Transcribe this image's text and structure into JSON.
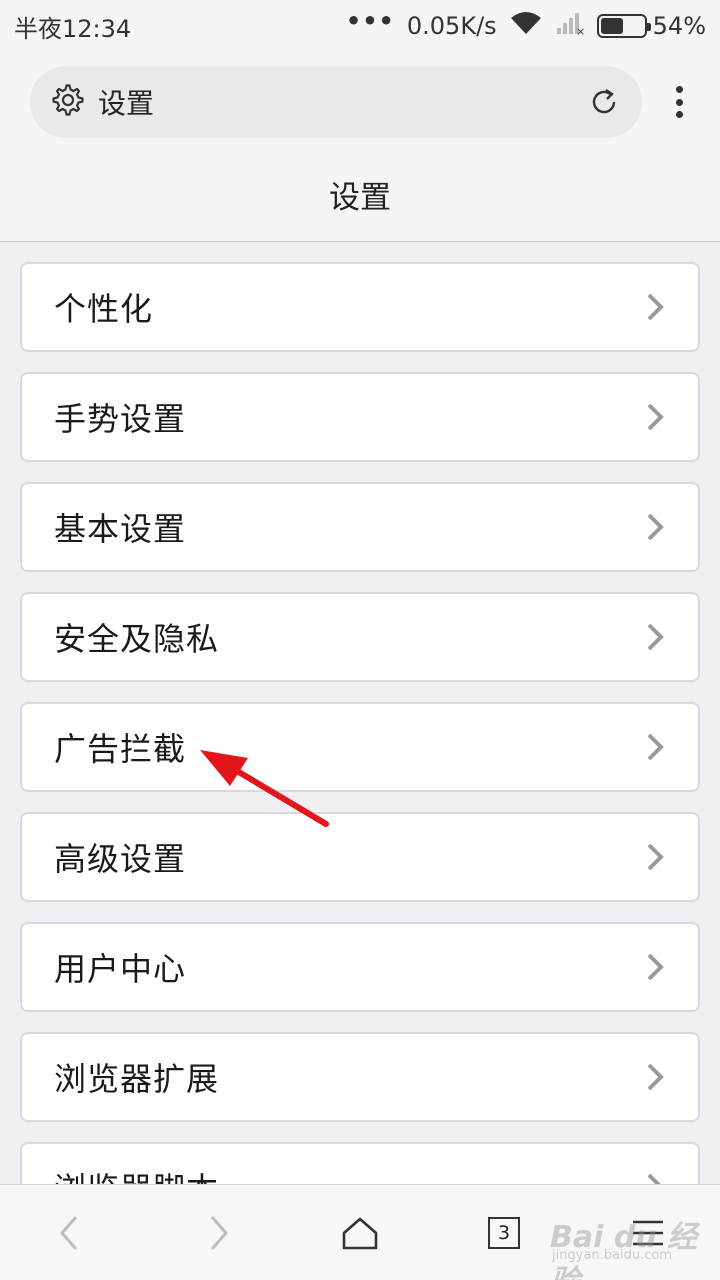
{
  "status_bar": {
    "time": "半夜12:34",
    "network_speed": "0.05K/s",
    "battery_percent": "54%",
    "battery_level": 0.54
  },
  "browser": {
    "url_bar_text": "设置",
    "page_title": "设置",
    "tab_count": "3"
  },
  "settings_items": [
    {
      "label": "个性化"
    },
    {
      "label": "手势设置"
    },
    {
      "label": "基本设置"
    },
    {
      "label": "安全及隐私"
    },
    {
      "label": "广告拦截"
    },
    {
      "label": "高级设置"
    },
    {
      "label": "用户中心"
    },
    {
      "label": "浏览器扩展"
    },
    {
      "label": "浏览器脚本"
    }
  ],
  "watermark": {
    "text": "Bai du 经验",
    "subtext": "jingyan.baidu.com"
  },
  "colors": {
    "annotation_arrow": "#e3161b",
    "background": "#efeff4"
  },
  "icons": [
    "gear-icon",
    "refresh-icon",
    "more-menu-icon",
    "chevron-right-icon",
    "back-icon",
    "forward-icon",
    "home-icon",
    "tabs-icon",
    "menu-icon"
  ]
}
